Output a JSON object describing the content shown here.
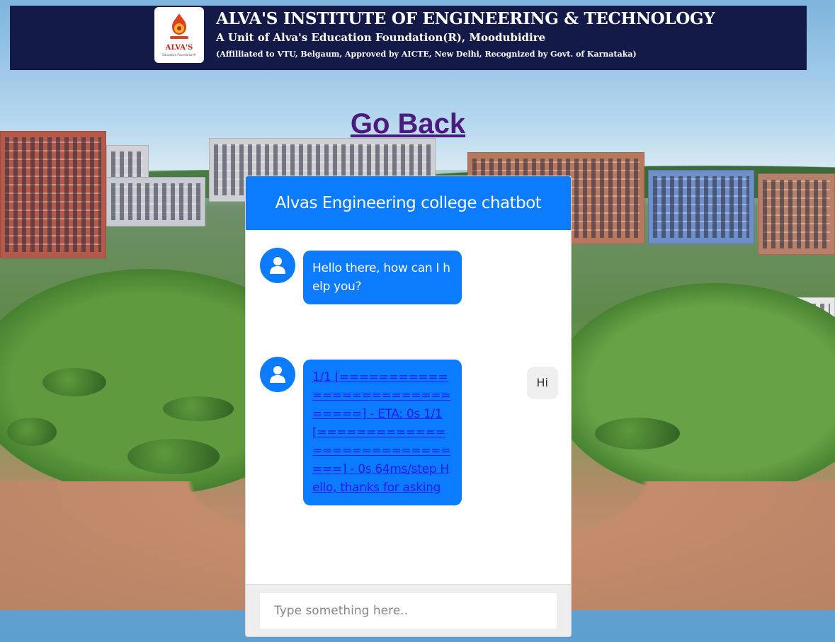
{
  "header": {
    "title": "ALVA'S INSTITUTE OF ENGINEERING & TECHNOLOGY",
    "subtitle": "A Unit of Alva's Education Foundation(R), Moodubidire",
    "affiliation": "(Affilliated to VTU, Belgaum, Approved by AICTE, New Delhi, Recognized by Govt. of Karnataka)",
    "logo_text": "ALVA'S",
    "logo_subtext": "Education Foundation®"
  },
  "nav": {
    "go_back_label": "Go Back"
  },
  "chat": {
    "title": "Alvas Engineering college chatbot",
    "messages": [
      {
        "sender": "bot",
        "text": "Hello there, how can I help you?"
      },
      {
        "sender": "user",
        "text": "Hi"
      },
      {
        "sender": "bot",
        "text": "1/1 [==============================] - ETA: 0s 1/1 [==============================] - 0s 64ms/step Hello, thanks for asking"
      }
    ],
    "input_placeholder": "Type something here.."
  },
  "colors": {
    "header_bg": "#141a47",
    "accent": "#0b7bff",
    "go_back": "#4b1b7f"
  }
}
